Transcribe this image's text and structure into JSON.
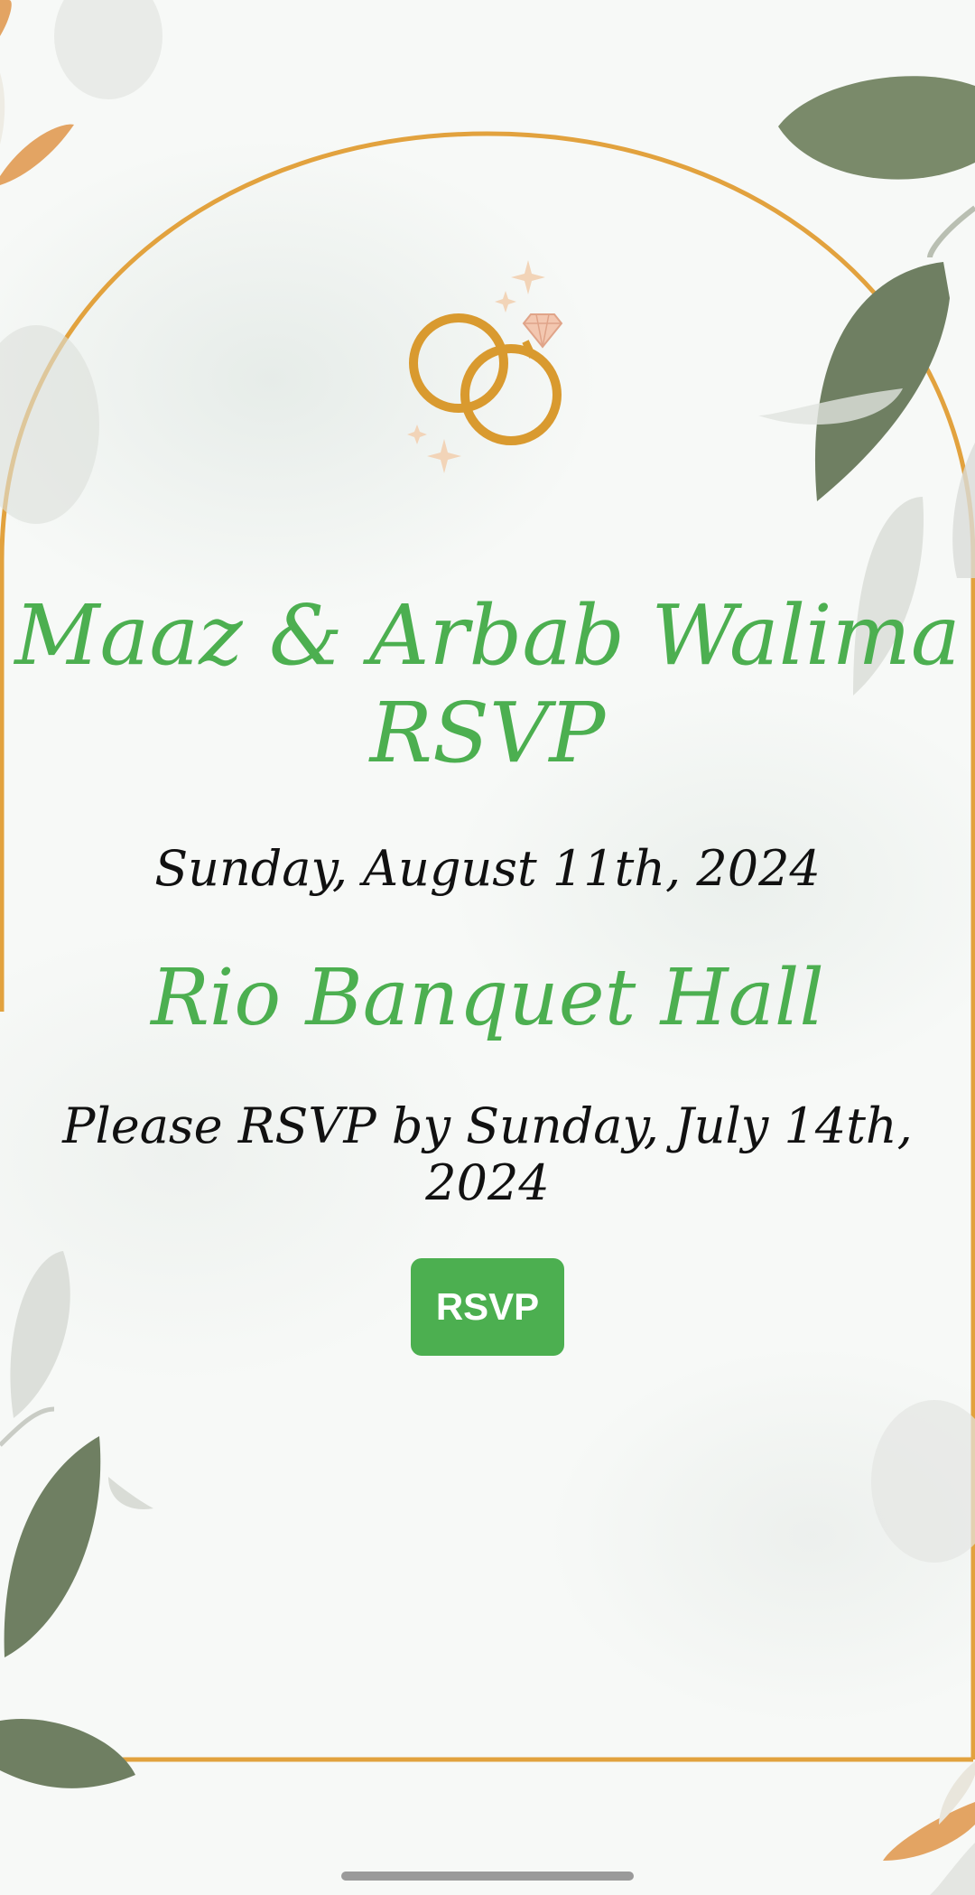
{
  "invitation": {
    "title": "Maaz & Arbab Walima RSVP",
    "date": "Sunday, August 11th, 2024",
    "venue": "Rio Banquet Hall",
    "deadline": "Please RSVP by Sunday, July 14th, 2024",
    "rsvp_button_label": "RSVP"
  },
  "icons": {
    "emblem": "wedding-rings-icon",
    "decor": [
      "leaf-icon",
      "sparkle-icon"
    ]
  },
  "colors": {
    "accent_green": "#4caf50",
    "gold": "#e2a23e",
    "leaf": "#6f7f62",
    "text": "#111111"
  }
}
